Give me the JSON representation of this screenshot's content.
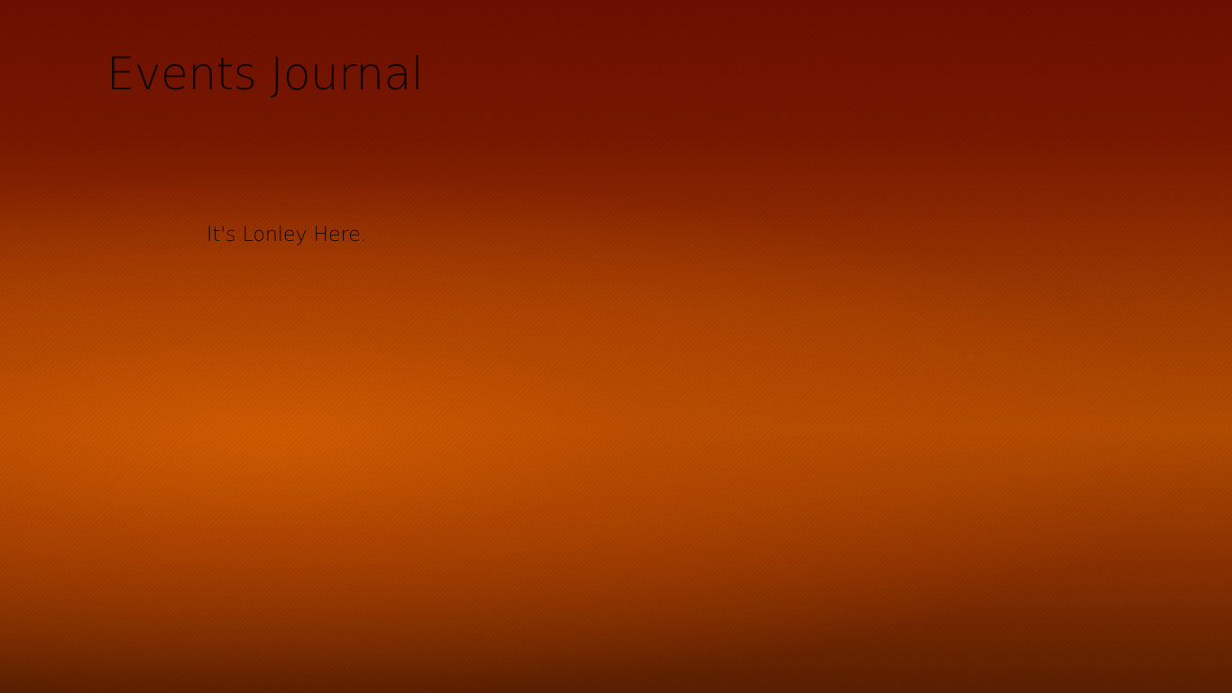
{
  "app": {
    "title": "Events Journal"
  },
  "main": {
    "empty_message": "It's Lonley Here."
  },
  "theme": {
    "background_top": "#6e0f00",
    "background_mid": "#c25200",
    "background_bottom": "#5a1f00",
    "text_color": "#120400"
  }
}
